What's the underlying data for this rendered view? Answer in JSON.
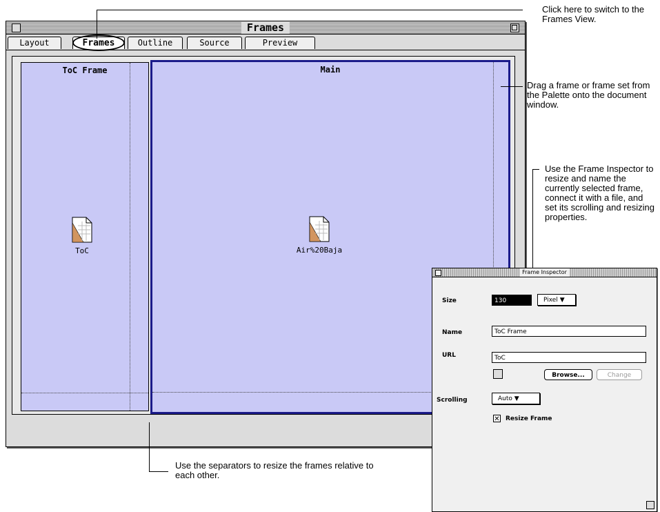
{
  "window": {
    "title": "Frames",
    "tabs": [
      {
        "label": "Layout"
      },
      {
        "label": "Frames"
      },
      {
        "label": "Outline"
      },
      {
        "label": "Source"
      },
      {
        "label": "Preview"
      }
    ],
    "active_tab": "Frames"
  },
  "frames": {
    "toc": {
      "name": "ToC Frame",
      "doc_label": "ToC"
    },
    "main": {
      "name": "Main",
      "doc_label": "Air%20Baja"
    }
  },
  "callouts": {
    "tabs": "Click here to switch to the Frames View.",
    "drag": "Drag a frame or frame set from the Palette onto the document window.",
    "inspector": "Use the Frame Inspector to resize and name the currently selected frame, connect it with a file, and set its scrolling and resizing properties.",
    "separators": "Use the separators to resize the frames relative to each other."
  },
  "inspector": {
    "title": "Frame Inspector",
    "size_label": "Size",
    "size_value": "130",
    "size_unit": "Pixel",
    "name_label": "Name",
    "name_value": "ToC Frame",
    "url_label": "URL",
    "url_value": "ToC",
    "browse_label": "Browse...",
    "change_label": "Change",
    "scrolling_label": "Scrolling",
    "scrolling_value": "Auto",
    "resize_label": "Resize Frame",
    "resize_checked": true
  }
}
